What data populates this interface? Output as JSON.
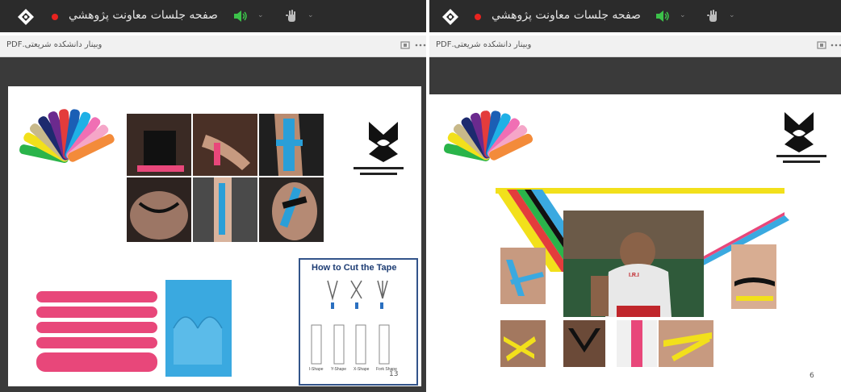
{
  "left_window": {
    "title": "صفحه جلسات معاونت پژوهشي",
    "document_name": "وبینار دانشکده شریعتی.PDF",
    "page_number": "13",
    "cut_panel": {
      "title": "How to Cut the Tape",
      "shapes": [
        "I-Shape",
        "Y-Shape",
        "X-Shape",
        "Fork Shape"
      ]
    }
  },
  "right_window": {
    "title": "صفحه جلسات معاونت پژوهشي",
    "document_name": "وبینار دانشکده شریعتی.PDF",
    "page_number": "6",
    "athlete_label": "I.R.I"
  },
  "icons": {
    "app_logo": "app-logo-icon",
    "record": "record-dot-icon",
    "speaker": "speaker-icon",
    "hand": "raise-hand-icon",
    "chevron": "chevron-down-icon",
    "fit": "fit-page-icon",
    "more": "more-options-icon"
  },
  "colors": {
    "topbar": "#2b2b2b",
    "record": "#e8231f",
    "speaker": "#3cc24a",
    "tape_pink": "#e8477a",
    "tape_blue": "#3aa9e0"
  }
}
